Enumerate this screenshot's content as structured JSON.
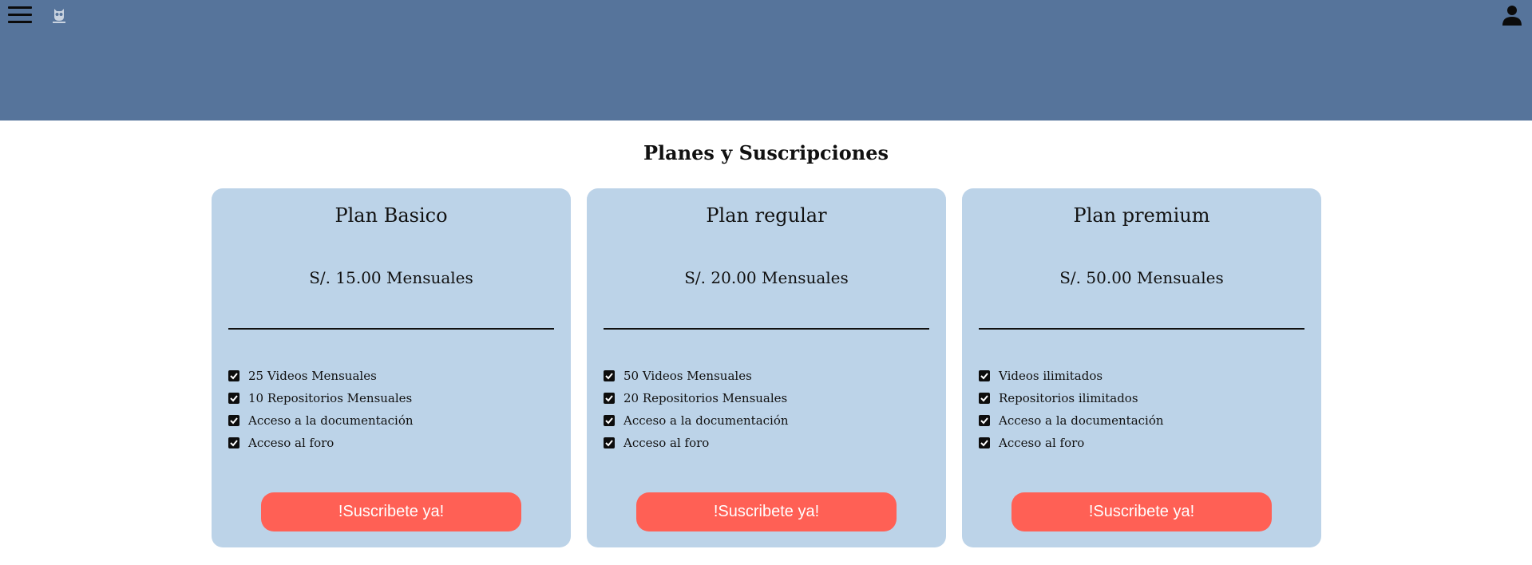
{
  "header": {
    "menu_icon": "hamburger-menu-icon",
    "logo_icon": "owl-logo-icon",
    "user_icon": "user-account-icon",
    "background_color": "#56749b"
  },
  "main": {
    "title": "Planes y Suscripciones"
  },
  "plans": [
    {
      "name": "Plan Basico",
      "price": "S/. 15.00 Mensuales",
      "features": [
        "25 Videos Mensuales",
        "10 Repositorios Mensuales",
        "Acceso a la documentación",
        "Acceso al foro"
      ],
      "cta": "!Suscribete ya!"
    },
    {
      "name": "Plan regular",
      "price": "S/. 20.00 Mensuales",
      "features": [
        "50 Videos Mensuales",
        "20 Repositorios Mensuales",
        "Acceso a la documentación",
        "Acceso al foro"
      ],
      "cta": "!Suscribete ya!"
    },
    {
      "name": "Plan premium",
      "price": "S/. 50.00 Mensuales",
      "features": [
        "Videos ilimitados",
        "Repositorios ilimitados",
        "Acceso a la documentación",
        "Acceso al foro"
      ],
      "cta": "!Suscribete ya!"
    }
  ],
  "colors": {
    "card_background": "#bcd3e8",
    "button": "#ff6055",
    "button_text": "#ffffff"
  }
}
